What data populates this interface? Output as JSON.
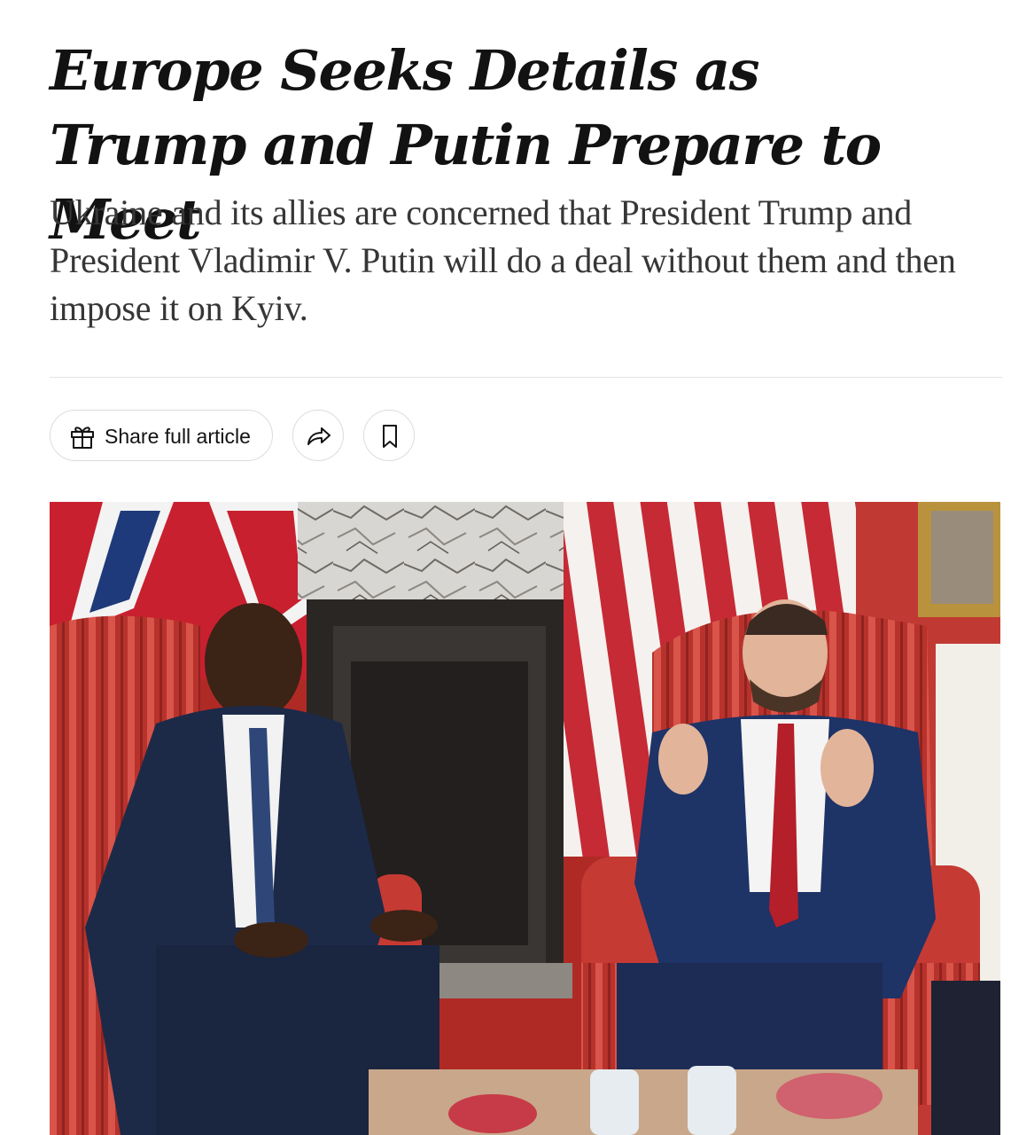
{
  "article": {
    "headline": "Europe Seeks Details as Trump and Putin Prepare to Meet",
    "summary": "Ukraine and its allies are concerned that President Trump and President Vladimir V. Putin will do a deal without them and then impose it on Kyiv."
  },
  "toolbar": {
    "share_full_label": "Share full article",
    "gift_icon": "gift-icon",
    "share_icon": "share-arrow-icon",
    "bookmark_icon": "bookmark-icon"
  },
  "colors": {
    "headline_text": "#121212",
    "summary_text": "#363636",
    "border": "#dcdcdc"
  }
}
